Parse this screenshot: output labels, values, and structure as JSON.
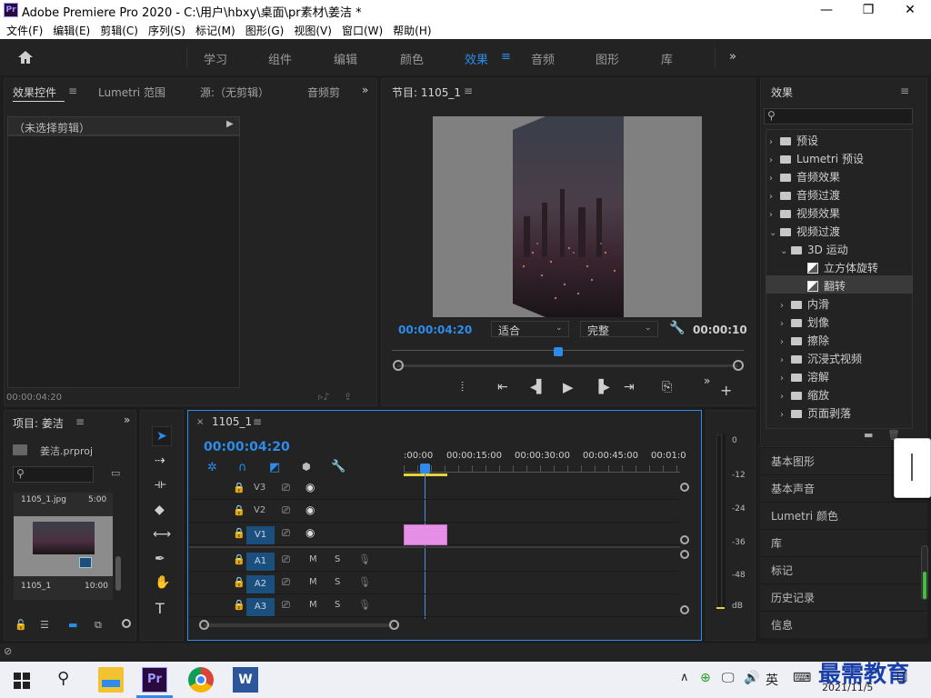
{
  "titlebar": {
    "logo": "Pr",
    "title": "Adobe Premiere Pro 2020 - C:\\用户\\hbxy\\桌面\\pr素材\\姜洁 *",
    "min": "—",
    "max": "❐",
    "close": "✕"
  },
  "menu": [
    "文件(F)",
    "编辑(E)",
    "剪辑(C)",
    "序列(S)",
    "标记(M)",
    "图形(G)",
    "视图(V)",
    "窗口(W)",
    "帮助(H)"
  ],
  "workspaces": [
    {
      "label": "学习",
      "active": false
    },
    {
      "label": "组件",
      "active": false
    },
    {
      "label": "编辑",
      "active": false
    },
    {
      "label": "颜色",
      "active": false
    },
    {
      "label": "效果",
      "active": true
    },
    {
      "label": "音频",
      "active": false
    },
    {
      "label": "图形",
      "active": false
    },
    {
      "label": "库",
      "active": false
    }
  ],
  "source_panel": {
    "tabs": [
      "效果控件",
      "Lumetri 范围",
      "源:（无剪辑）",
      "音频剪"
    ],
    "no_clip": "（未选择剪辑）",
    "timecode": "00:00:04:20"
  },
  "program": {
    "title": "节目: 1105_1",
    "timecode": "00:00:04:20",
    "fit": "适合",
    "quality": "完整",
    "duration": "00:00:10"
  },
  "effects": {
    "title": "效果",
    "items": [
      {
        "label": "预设",
        "depth": 0,
        "kind": "special",
        "open": false
      },
      {
        "label": "Lumetri 预设",
        "depth": 0,
        "kind": "special",
        "open": false
      },
      {
        "label": "音频效果",
        "depth": 0,
        "kind": "folder",
        "open": false
      },
      {
        "label": "音频过渡",
        "depth": 0,
        "kind": "folder",
        "open": false
      },
      {
        "label": "视频效果",
        "depth": 0,
        "kind": "folder",
        "open": false
      },
      {
        "label": "视频过渡",
        "depth": 0,
        "kind": "folder",
        "open": true
      },
      {
        "label": "3D 运动",
        "depth": 1,
        "kind": "folder",
        "open": true
      },
      {
        "label": "立方体旋转",
        "depth": 2,
        "kind": "fx",
        "open": false
      },
      {
        "label": "翻转",
        "depth": 2,
        "kind": "fx",
        "open": false,
        "selected": true
      },
      {
        "label": "内滑",
        "depth": 1,
        "kind": "folder",
        "open": false
      },
      {
        "label": "划像",
        "depth": 1,
        "kind": "folder",
        "open": false
      },
      {
        "label": "擦除",
        "depth": 1,
        "kind": "folder",
        "open": false
      },
      {
        "label": "沉浸式视频",
        "depth": 1,
        "kind": "folder",
        "open": false
      },
      {
        "label": "溶解",
        "depth": 1,
        "kind": "folder",
        "open": false
      },
      {
        "label": "缩放",
        "depth": 1,
        "kind": "folder",
        "open": false
      },
      {
        "label": "页面剥落",
        "depth": 1,
        "kind": "folder",
        "open": false
      }
    ]
  },
  "right_panels": [
    "基本图形",
    "基本声音",
    "Lumetri 颜色",
    "库",
    "标记",
    "历史记录",
    "信息"
  ],
  "project": {
    "title": "项目: 姜洁",
    "file": "姜洁.prproj",
    "item_name": "1105_1.jpg",
    "item_dur": "5:00",
    "seq_name": "1105_1",
    "seq_dur": "10:00"
  },
  "timeline": {
    "title": "1105_1",
    "timecode": "00:00:04:20",
    "ruler": [
      ":00:00",
      "00:00:15:00",
      "00:00:30:00",
      "00:00:45:00",
      "00:01:0"
    ],
    "video_tracks": [
      "V3",
      "V2",
      "V1"
    ],
    "audio_tracks": [
      "A1",
      "A2",
      "A3"
    ],
    "m": "M",
    "s": "S"
  },
  "meter": {
    "ticks": [
      "0",
      "-12",
      "-24",
      "-36",
      "-48",
      "dB"
    ]
  },
  "taskbar": {
    "ime": "英",
    "date": "2021/11/5",
    "watermark": "最需教育"
  },
  "colors": {
    "accent": "#2d8ceb",
    "clip": "#e58fe6",
    "track_blue": "#1b4f7d",
    "playhead": "#4b8fe3"
  }
}
